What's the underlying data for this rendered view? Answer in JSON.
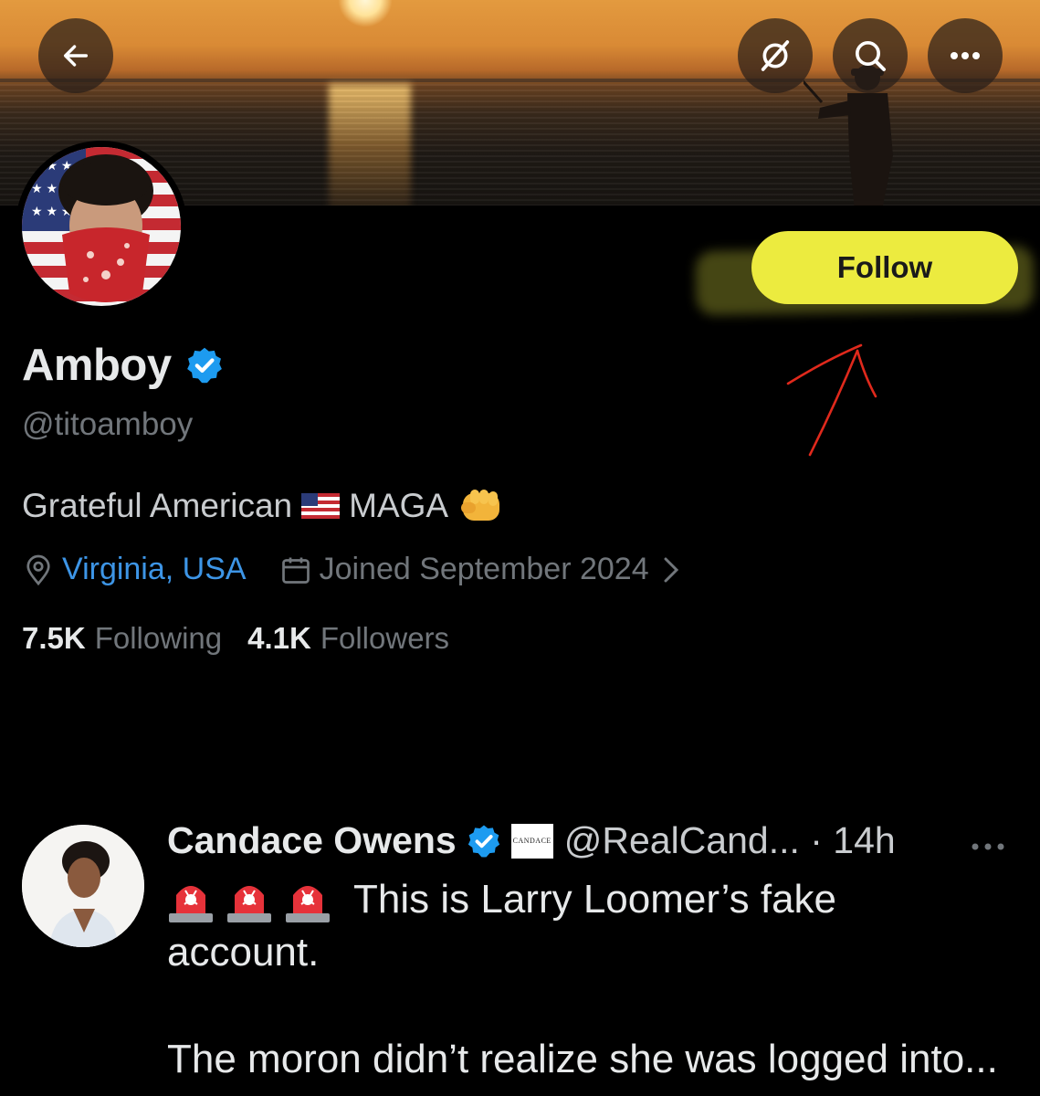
{
  "header": {
    "back_icon": "arrow-left-icon",
    "grok_icon": "grok-slash-icon",
    "search_icon": "search-icon",
    "more_icon": "more-horizontal-icon"
  },
  "profile": {
    "follow_label": "Follow",
    "display_name": "Amboy",
    "handle": "@titoamboy",
    "bio_text_1": "Grateful American",
    "bio_text_2": "MAGA",
    "location": "Virginia, USA",
    "joined": "Joined September 2024",
    "following_count": "7.5K",
    "following_label": "Following",
    "followers_count": "4.1K",
    "followers_label": "Followers"
  },
  "tweet": {
    "author_name": "Candace Owens",
    "affiliate_badge_text": "CANDACE",
    "author_handle_time": "@RealCand... · 14h",
    "text_line1": "This is Larry Loomer’s fake",
    "text_line2": "account.",
    "text_line3": "The moron didn’t realize she was logged into..."
  },
  "colors": {
    "background": "#000000",
    "follow_button": "#eceb3f",
    "link_blue": "#3d95e6",
    "verified_blue": "#1d9bf0",
    "muted_text": "#71767b",
    "annotation_red": "#e0291c"
  }
}
